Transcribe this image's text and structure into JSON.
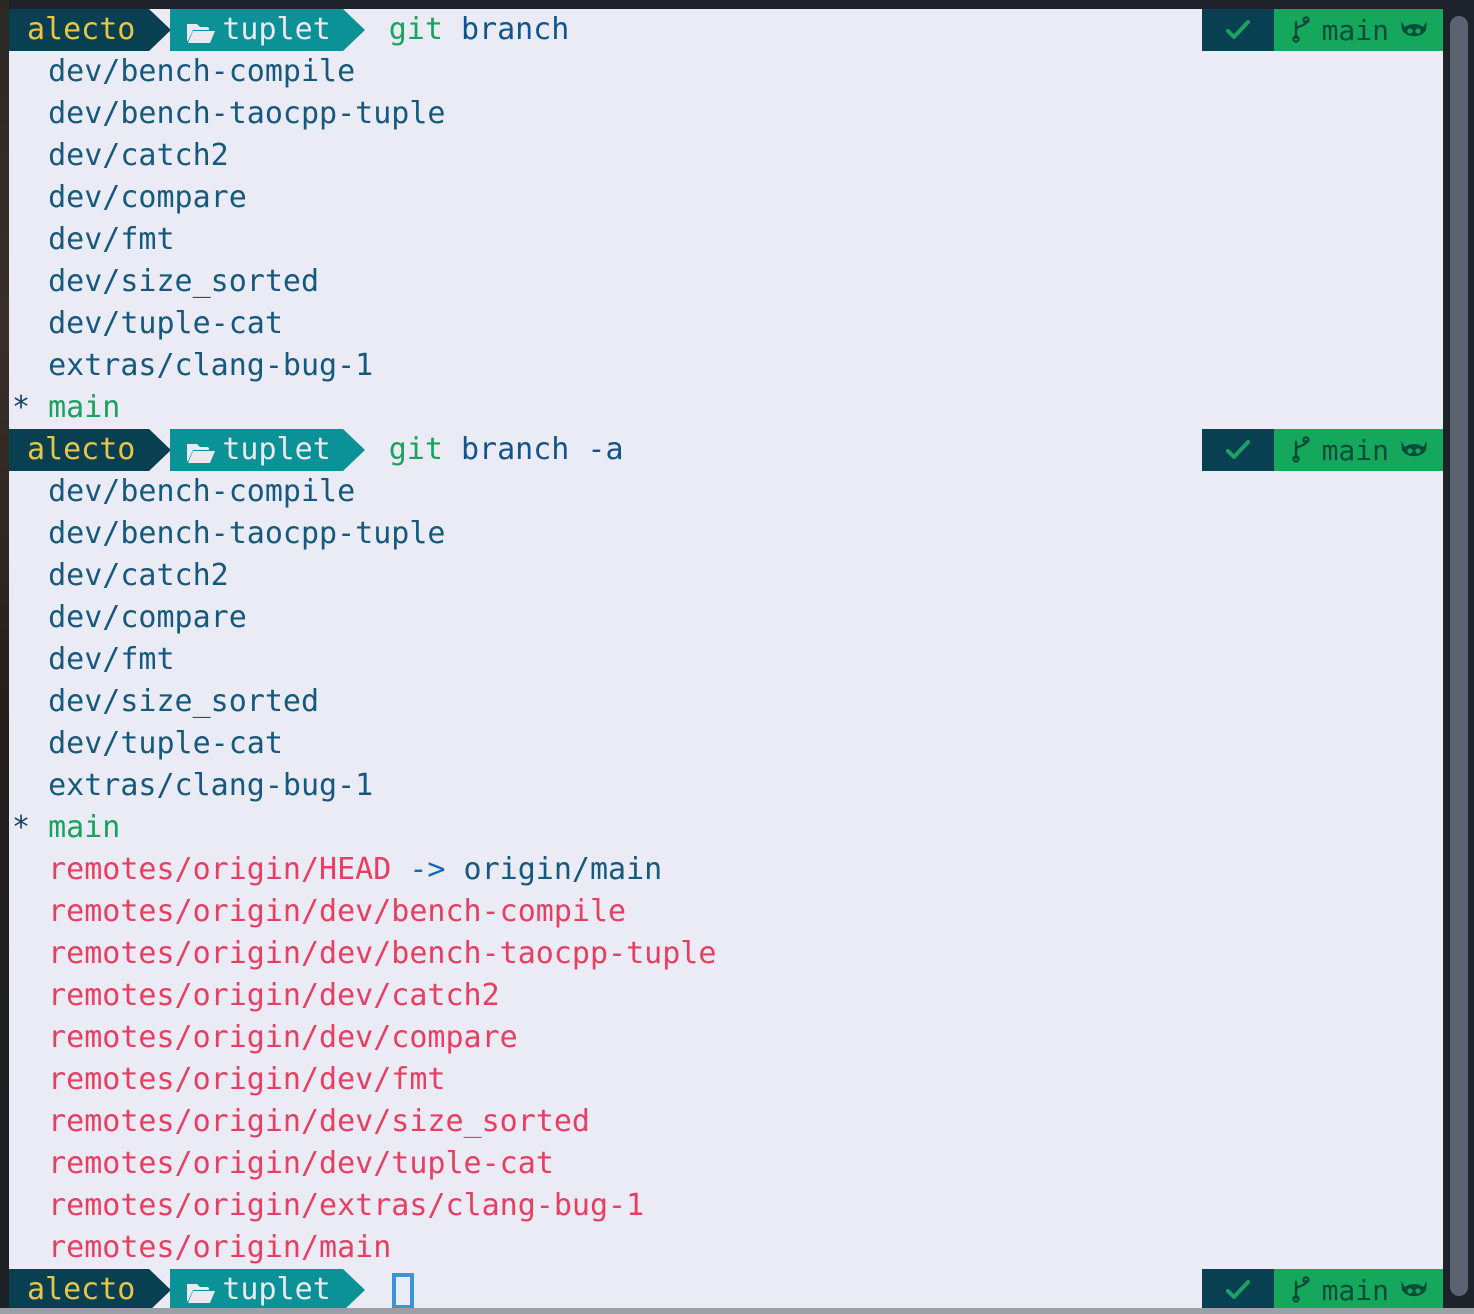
{
  "terminal": {
    "shell_theme": "powerline",
    "background": "#ebebf5",
    "foreground": "#15597d",
    "window_chrome": "#1e232b",
    "scrollbar_thumb": "#5c6370"
  },
  "prompt": {
    "user": "alecto",
    "directory": "tuplet",
    "folder_icon": "open-folder-icon",
    "status_ok_icon": "checkmark-icon",
    "git_icon": "git-branch-icon",
    "git_branch": "main",
    "vcs_host_icon": "github-octocat-icon",
    "colors": {
      "user_bg": "#084052",
      "user_fg": "#e8c547",
      "dir_bg": "#0b9296",
      "dir_fg": "#e9e9ef",
      "status_ok_bg": "#084052",
      "status_ok_fg": "#1aa260",
      "git_bg": "#15a85c",
      "git_fg": "#084052"
    }
  },
  "blocks": [
    {
      "command_verb": "git",
      "command_rest": " branch",
      "output": [
        {
          "text": "  dev/bench-compile",
          "kind": "local"
        },
        {
          "text": "  dev/bench-taocpp-tuple",
          "kind": "local"
        },
        {
          "text": "  dev/catch2",
          "kind": "local"
        },
        {
          "text": "  dev/compare",
          "kind": "local"
        },
        {
          "text": "  dev/fmt",
          "kind": "local"
        },
        {
          "text": "  dev/size_sorted",
          "kind": "local"
        },
        {
          "text": "  dev/tuple-cat",
          "kind": "local"
        },
        {
          "text": "  extras/clang-bug-1",
          "kind": "local"
        },
        {
          "text": "main",
          "kind": "current",
          "marker": "* "
        }
      ]
    },
    {
      "command_verb": "git",
      "command_rest": " branch -a",
      "output": [
        {
          "text": "  dev/bench-compile",
          "kind": "local"
        },
        {
          "text": "  dev/bench-taocpp-tuple",
          "kind": "local"
        },
        {
          "text": "  dev/catch2",
          "kind": "local"
        },
        {
          "text": "  dev/compare",
          "kind": "local"
        },
        {
          "text": "  dev/fmt",
          "kind": "local"
        },
        {
          "text": "  dev/size_sorted",
          "kind": "local"
        },
        {
          "text": "  dev/tuple-cat",
          "kind": "local"
        },
        {
          "text": "  extras/clang-bug-1",
          "kind": "local"
        },
        {
          "text": "main",
          "kind": "current",
          "marker": "* "
        },
        {
          "text": "  remotes/origin/HEAD",
          "kind": "remote-head",
          "arrow": " -> ",
          "target": "origin/main"
        },
        {
          "text": "  remotes/origin/dev/bench-compile",
          "kind": "remote"
        },
        {
          "text": "  remotes/origin/dev/bench-taocpp-tuple",
          "kind": "remote"
        },
        {
          "text": "  remotes/origin/dev/catch2",
          "kind": "remote"
        },
        {
          "text": "  remotes/origin/dev/compare",
          "kind": "remote"
        },
        {
          "text": "  remotes/origin/dev/fmt",
          "kind": "remote"
        },
        {
          "text": "  remotes/origin/dev/size_sorted",
          "kind": "remote"
        },
        {
          "text": "  remotes/origin/dev/tuple-cat",
          "kind": "remote"
        },
        {
          "text": "  remotes/origin/extras/clang-bug-1",
          "kind": "remote"
        },
        {
          "text": "  remotes/origin/main",
          "kind": "remote"
        }
      ]
    },
    {
      "command_verb": "",
      "command_rest": "",
      "cursor": true,
      "output": []
    }
  ]
}
